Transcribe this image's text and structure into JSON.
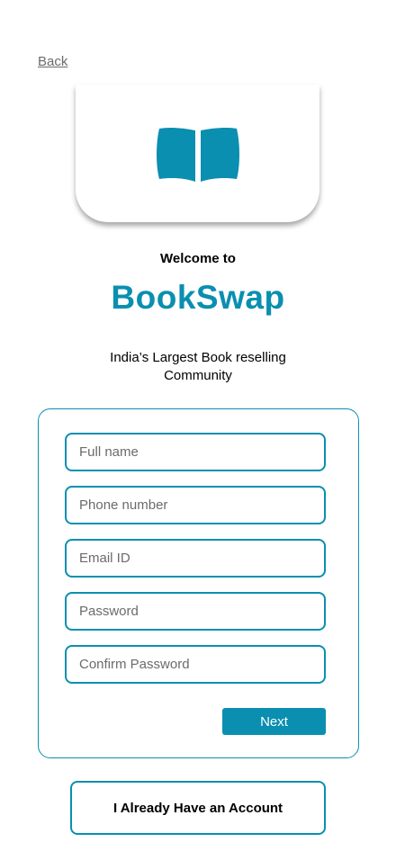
{
  "nav": {
    "back_label": "Back"
  },
  "logo": {
    "icon": "open-book-icon",
    "color": "#0a8fb0"
  },
  "header": {
    "welcome": "Welcome to",
    "brand": "BookSwap",
    "tagline": "India’s Largest Book reselling Community"
  },
  "form": {
    "full_name": {
      "placeholder": "Full name",
      "value": ""
    },
    "phone": {
      "placeholder": "Phone number",
      "value": ""
    },
    "email": {
      "placeholder": "Email ID",
      "value": ""
    },
    "password": {
      "placeholder": "Password",
      "value": ""
    },
    "confirm_password": {
      "placeholder": "Confirm Password",
      "value": ""
    },
    "next_label": "Next"
  },
  "footer": {
    "account_label": "I Already Have an Account"
  },
  "colors": {
    "accent": "#0a8fb0",
    "text": "#000000",
    "muted": "#6b6b6b"
  }
}
